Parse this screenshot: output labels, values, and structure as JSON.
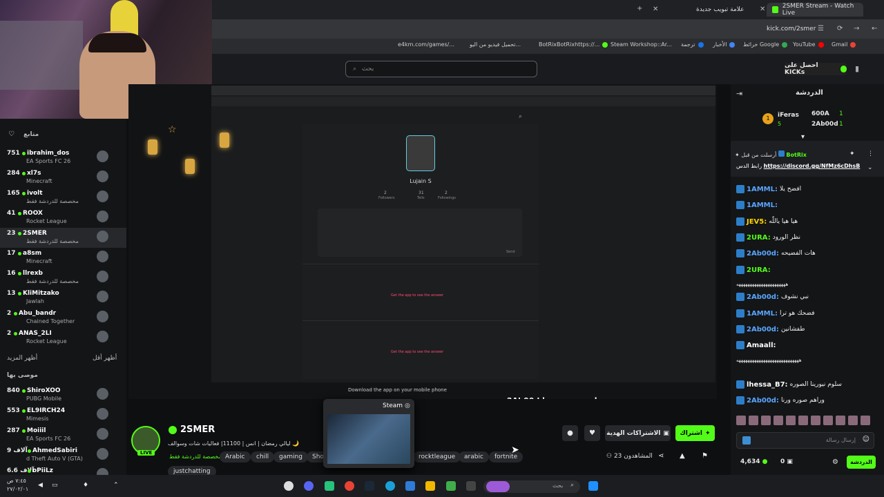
{
  "browser": {
    "tabs": [
      {
        "label": "2SMER Stream - Watch Live",
        "active": true
      },
      {
        "label": "علامة تبويب جديدة",
        "active": false
      }
    ],
    "url": "kick.com/2smer",
    "bookmarks": [
      "Gmail",
      "YouTube",
      "خرائط Google",
      "الأخبار",
      "ترجمة",
      "Steam Workshop::Ar...",
      "BotRixBotRixhttps://...",
      "تحميل فيديو من اليو...",
      "e4km.com/games/..."
    ]
  },
  "header": {
    "search_placeholder": "بحث",
    "get_kicks": "احصل على KICKs"
  },
  "sidebar": {
    "following_label": "متابع",
    "recommended_label": "موصى بها",
    "show_more": "أظهر المزيد",
    "show_less": "أظهر أقل",
    "following": [
      {
        "count": "751",
        "name": "ibrahim_dos",
        "game": "EA Sports FC 26"
      },
      {
        "count": "284",
        "name": "xl7s",
        "game": "Minecraft"
      },
      {
        "count": "165",
        "name": "ivolt",
        "game": "مخصصة للدردشة فقط"
      },
      {
        "count": "41",
        "name": "ROOX",
        "game": "Rocket League"
      },
      {
        "count": "23",
        "name": "2SMER",
        "game": "مخصصة للدردشة فقط"
      },
      {
        "count": "17",
        "name": "a8sm",
        "game": "Minecraft"
      },
      {
        "count": "16",
        "name": "llrexb",
        "game": "مخصصة للدردشة فقط"
      },
      {
        "count": "13",
        "name": "KliMitzako",
        "game": "Jawlah"
      },
      {
        "count": "2",
        "name": "Abu_bandr",
        "game": "Chained Together"
      },
      {
        "count": "2",
        "name": "ANAS_2LI",
        "game": "Rocket League"
      }
    ],
    "recommended": [
      {
        "count": "840",
        "name": "ShiroXOO",
        "game": "PUBG Mobile"
      },
      {
        "count": "553",
        "name": "EL9IRCH24",
        "game": "Mimesis"
      },
      {
        "count": "287",
        "name": "Moiiil",
        "game": "EA Sports FC 26"
      },
      {
        "count": "9 آلاف",
        "name": "AhmedSabiri",
        "game": "d Theft Auto V (GTA)"
      },
      {
        "count": "6.6 آلاف",
        "name": "oPiiLz",
        "game": ""
      }
    ]
  },
  "player": {
    "profile_name": "Lujain S",
    "followers_label": "Followers",
    "followers": "2",
    "tells_label": "Tells",
    "tells": "31",
    "following_label": "Followings",
    "following": "2",
    "send_label": "Send",
    "get_app": "Get the app to see the answer",
    "download": "Download the app on your mobile phone",
    "overlay_text": "2Ab00d  وراهم صوره ورنا"
  },
  "stream": {
    "channel": "2SMER",
    "live": "LIVE",
    "title": "ليالي رمضان | انس | 11100| فعاليات شات وسوالف 🌙",
    "category": "مخصصة للدردشة فقط",
    "tags": [
      "Arabic",
      "chill",
      "gaming",
      "Sho",
      "rocktleague",
      "arabic",
      "fortnite",
      "justchatting"
    ],
    "subscribe": "اشتراك",
    "gift_subs": "الاشتراكات الهدية",
    "viewers": "23",
    "viewers_label": "المشاهدون"
  },
  "steam_popup": {
    "label": "Steam"
  },
  "chat": {
    "title": "الدردشة",
    "top": [
      {
        "rank": "1",
        "name": "iFeras",
        "val": "5"
      },
      {
        "rank": "1",
        "name": "600A",
        "val": ""
      },
      {
        "rank": "1",
        "name": "2Ab00d",
        "val": ""
      }
    ],
    "pinned_by": "أرسلت من قبل",
    "pinned_user": "BotRix",
    "pinned_text": "رابط الدس",
    "pinned_link": "https://discord.gg/NfMz6cDhsB",
    "messages": [
      {
        "user": "1AMML:",
        "text": "افضح يلا",
        "color": "#59a6ff"
      },
      {
        "user": "1AMML:",
        "text": "",
        "color": "#59a6ff"
      },
      {
        "user": "JEV5:",
        "text": "هيا هيا ياللّه",
        "color": "#ffd400"
      },
      {
        "user": "2URA:",
        "text": "نظر الورود",
        "color": "#53fc18"
      },
      {
        "user": "2Ab00d:",
        "text": "هات الفضيحه",
        "color": "#59a6ff"
      },
      {
        "user": "2URA:",
        "text": "",
        "color": "#53fc18"
      },
      {
        "user": "",
        "text": "ههههههههههههههههههههههه",
        "color": "#eee"
      },
      {
        "user": "2Ab00d:",
        "text": "نبي نشوف",
        "color": "#59a6ff"
      },
      {
        "user": "1AMML:",
        "text": "فضحك هو ترا",
        "color": "#59a6ff"
      },
      {
        "user": "2Ab00d:",
        "text": "طفشانين",
        "color": "#59a6ff"
      },
      {
        "user": "Amaall:",
        "text": "",
        "color": "#ffffff"
      },
      {
        "user": "",
        "text": "ههههههههههههههههههههههههههههه",
        "color": "#eee"
      },
      {
        "user": "lhessa_B7:",
        "text": "سلوم نيورينا الصوره",
        "color": "#ffffff"
      },
      {
        "user": "2Ab00d:",
        "text": "وراهم صوره ورنا",
        "color": "#59a6ff"
      }
    ],
    "input_placeholder": "إرسال رسالة",
    "send": "الدردشة",
    "points": "4,634",
    "zero": "0"
  },
  "taskbar": {
    "search": "بحث",
    "time": "٧:٤٥ ص",
    "date": "٢٧/٠٢/٠١"
  }
}
